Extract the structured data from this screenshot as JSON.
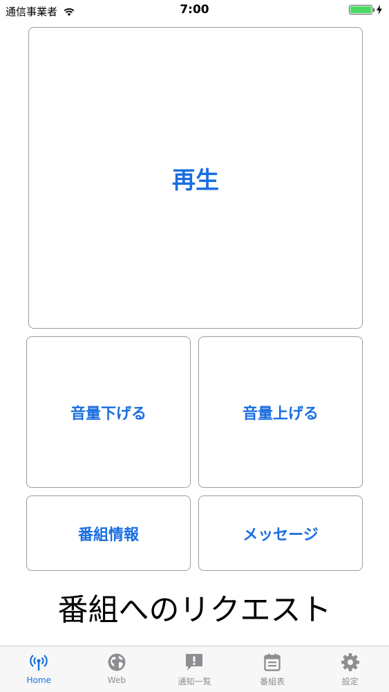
{
  "status_bar": {
    "carrier": "通信事業者",
    "time": "7:00",
    "battery_level": 1.0
  },
  "controls": {
    "play_label": "再生",
    "volume_down_label": "音量下げる",
    "volume_up_label": "音量上げる",
    "program_info_label": "番組情報",
    "message_label": "メッセージ"
  },
  "request_title": "番組へのリクエスト",
  "tabbar": {
    "tabs": [
      {
        "label": "Home",
        "icon": "broadcast-icon",
        "active": true
      },
      {
        "label": "Web",
        "icon": "globe-icon",
        "active": false
      },
      {
        "label": "通知一覧",
        "icon": "notification-icon",
        "active": false
      },
      {
        "label": "番組表",
        "icon": "calendar-icon",
        "active": false
      },
      {
        "label": "設定",
        "icon": "gear-icon",
        "active": false
      }
    ]
  },
  "colors": {
    "accent": "#1a6ee0",
    "inactive": "#8e8e93",
    "battery": "#4cd964"
  }
}
